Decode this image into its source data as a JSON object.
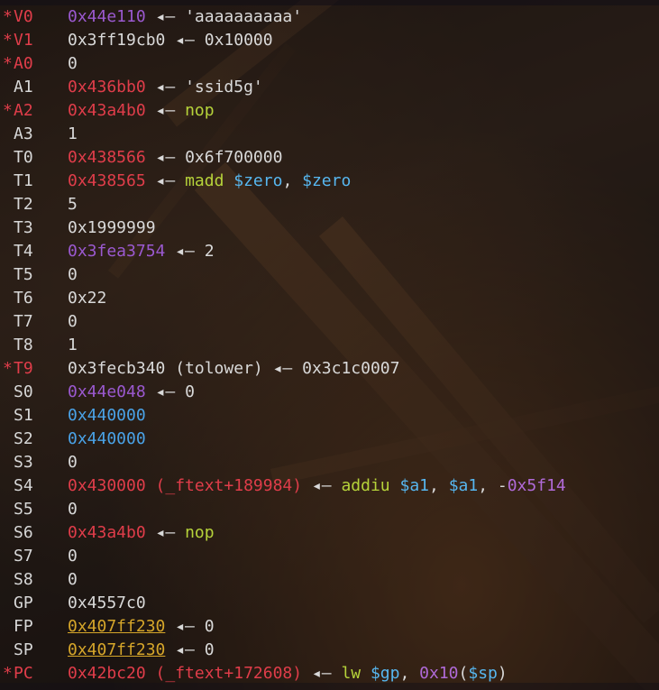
{
  "theme": {
    "changed_marker_color": "#e03d4a",
    "heap_color": "#9b59d0",
    "code_color": "#e03d4a",
    "data_color": "#4aa3e8",
    "stack_color": "#d6a62a",
    "instruction_color": "#b6d33a",
    "register_color": "#57b7f0"
  },
  "registers": [
    {
      "marker": "*",
      "name": "V0",
      "value": "0x44e110",
      "value_class": "heap",
      "symbol": "",
      "deref": [
        {
          "t": "arrow",
          "v": " ◂— "
        },
        {
          "t": "str",
          "v": "'aaaaaaaaaa'"
        }
      ]
    },
    {
      "marker": "*",
      "name": "V1",
      "value": "0x3ff19cb0",
      "value_class": "default",
      "symbol": "",
      "deref": [
        {
          "t": "arrow",
          "v": " ◂— "
        },
        {
          "t": "str",
          "v": "0x10000"
        }
      ]
    },
    {
      "marker": "*",
      "name": "A0",
      "value": "0",
      "value_class": "default",
      "symbol": "",
      "deref": []
    },
    {
      "marker": "",
      "name": "A1",
      "value": "0x436bb0",
      "value_class": "code",
      "symbol": "",
      "deref": [
        {
          "t": "arrow",
          "v": " ◂— "
        },
        {
          "t": "str",
          "v": "'ssid5g'"
        }
      ]
    },
    {
      "marker": "*",
      "name": "A2",
      "value": "0x43a4b0",
      "value_class": "code",
      "symbol": "",
      "deref": [
        {
          "t": "arrow",
          "v": " ◂— "
        },
        {
          "t": "mn",
          "v": "nop"
        }
      ]
    },
    {
      "marker": "",
      "name": "A3",
      "value": "1",
      "value_class": "default",
      "symbol": "",
      "deref": []
    },
    {
      "marker": "",
      "name": "T0",
      "value": "0x438566",
      "value_class": "code",
      "symbol": "",
      "deref": [
        {
          "t": "arrow",
          "v": " ◂— "
        },
        {
          "t": "str",
          "v": "0x6f700000"
        }
      ]
    },
    {
      "marker": "",
      "name": "T1",
      "value": "0x438565",
      "value_class": "code",
      "symbol": "",
      "deref": [
        {
          "t": "arrow",
          "v": " ◂— "
        },
        {
          "t": "mn",
          "v": "madd "
        },
        {
          "t": "reg",
          "v": "$zero"
        },
        {
          "t": "punct",
          "v": ", "
        },
        {
          "t": "reg",
          "v": "$zero"
        }
      ]
    },
    {
      "marker": "",
      "name": "T2",
      "value": "5",
      "value_class": "default",
      "symbol": "",
      "deref": []
    },
    {
      "marker": "",
      "name": "T3",
      "value": "0x1999999",
      "value_class": "default",
      "symbol": "",
      "deref": []
    },
    {
      "marker": "",
      "name": "T4",
      "value": "0x3fea3754",
      "value_class": "heap",
      "symbol": "",
      "deref": [
        {
          "t": "arrow",
          "v": " ◂— "
        },
        {
          "t": "str",
          "v": "2"
        }
      ]
    },
    {
      "marker": "",
      "name": "T5",
      "value": "0",
      "value_class": "default",
      "symbol": "",
      "deref": []
    },
    {
      "marker": "",
      "name": "T6",
      "value": "0x22",
      "value_class": "default",
      "symbol": "",
      "deref": []
    },
    {
      "marker": "",
      "name": "T7",
      "value": "0",
      "value_class": "default",
      "symbol": "",
      "deref": []
    },
    {
      "marker": "",
      "name": "T8",
      "value": "1",
      "value_class": "default",
      "symbol": "",
      "deref": []
    },
    {
      "marker": "*",
      "name": "T9",
      "value": "0x3fecb340 (tolower)",
      "value_class": "default",
      "symbol": "",
      "deref": [
        {
          "t": "arrow",
          "v": " ◂— "
        },
        {
          "t": "str",
          "v": "0x3c1c0007"
        }
      ]
    },
    {
      "marker": "",
      "name": "S0",
      "value": "0x44e048",
      "value_class": "heap",
      "symbol": "",
      "deref": [
        {
          "t": "arrow",
          "v": " ◂— "
        },
        {
          "t": "str",
          "v": "0"
        }
      ]
    },
    {
      "marker": "",
      "name": "S1",
      "value": "0x440000",
      "value_class": "data",
      "symbol": "",
      "deref": []
    },
    {
      "marker": "",
      "name": "S2",
      "value": "0x440000",
      "value_class": "data",
      "symbol": "",
      "deref": []
    },
    {
      "marker": "",
      "name": "S3",
      "value": "0",
      "value_class": "default",
      "symbol": "",
      "deref": []
    },
    {
      "marker": "",
      "name": "S4",
      "value": "0x430000",
      "value_class": "code",
      "symbol": " (_ftext+189984)",
      "deref": [
        {
          "t": "arrow",
          "v": " ◂— "
        },
        {
          "t": "mn",
          "v": "addiu "
        },
        {
          "t": "reg",
          "v": "$a1"
        },
        {
          "t": "punct",
          "v": ", "
        },
        {
          "t": "reg",
          "v": "$a1"
        },
        {
          "t": "punct",
          "v": ", -"
        },
        {
          "t": "imm",
          "v": "0x5f14"
        }
      ]
    },
    {
      "marker": "",
      "name": "S5",
      "value": "0",
      "value_class": "default",
      "symbol": "",
      "deref": []
    },
    {
      "marker": "",
      "name": "S6",
      "value": "0x43a4b0",
      "value_class": "code",
      "symbol": "",
      "deref": [
        {
          "t": "arrow",
          "v": " ◂— "
        },
        {
          "t": "mn",
          "v": "nop"
        }
      ]
    },
    {
      "marker": "",
      "name": "S7",
      "value": "0",
      "value_class": "default",
      "symbol": "",
      "deref": []
    },
    {
      "marker": "",
      "name": "S8",
      "value": "0",
      "value_class": "default",
      "symbol": "",
      "deref": []
    },
    {
      "marker": "",
      "name": "GP",
      "value": "0x4557c0",
      "value_class": "default",
      "symbol": "",
      "deref": []
    },
    {
      "marker": "",
      "name": "FP",
      "value": "0x407ff230",
      "value_class": "stack",
      "symbol": "",
      "deref": [
        {
          "t": "arrow",
          "v": " ◂— "
        },
        {
          "t": "str",
          "v": "0"
        }
      ]
    },
    {
      "marker": "",
      "name": "SP",
      "value": "0x407ff230",
      "value_class": "stack",
      "symbol": "",
      "deref": [
        {
          "t": "arrow",
          "v": " ◂— "
        },
        {
          "t": "str",
          "v": "0"
        }
      ]
    },
    {
      "marker": "*",
      "name": "PC",
      "value": "0x42bc20",
      "value_class": "code",
      "symbol": " (_ftext+172608)",
      "deref": [
        {
          "t": "arrow",
          "v": " ◂— "
        },
        {
          "t": "mn",
          "v": "lw "
        },
        {
          "t": "reg",
          "v": "$gp"
        },
        {
          "t": "punct",
          "v": ", "
        },
        {
          "t": "imm",
          "v": "0x10"
        },
        {
          "t": "punct",
          "v": "("
        },
        {
          "t": "reg",
          "v": "$sp"
        },
        {
          "t": "punct",
          "v": ")"
        }
      ]
    }
  ]
}
